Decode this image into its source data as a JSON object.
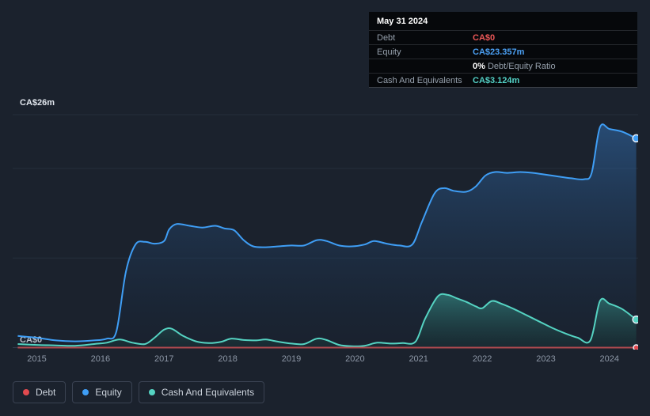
{
  "tooltip": {
    "date": "May 31 2024",
    "debt_label": "Debt",
    "debt_value": "CA$0",
    "equity_label": "Equity",
    "equity_value": "CA$23.357m",
    "ratio_value": "0%",
    "ratio_label": "Debt/Equity Ratio",
    "cash_label": "Cash And Equivalents",
    "cash_value": "CA$3.124m"
  },
  "axis": {
    "y_top_label": "CA$26m",
    "y_bottom_label": "CA$0"
  },
  "legend": [
    {
      "label": "Debt",
      "color": "#e14a4f"
    },
    {
      "label": "Equity",
      "color": "#3f9ef5"
    },
    {
      "label": "Cash And Equivalents",
      "color": "#55d3c2"
    }
  ],
  "chart_data": {
    "type": "area",
    "x_ticks": [
      2015,
      2016,
      2017,
      2018,
      2019,
      2020,
      2021,
      2022,
      2023,
      2024
    ],
    "xlim": [
      2014.62,
      2024.45
    ],
    "ylim": [
      0,
      26
    ],
    "y_gridlines": [
      26,
      20,
      10,
      0
    ],
    "y_tick_labels": {
      "top": "CA$26m",
      "bottom": "CA$0"
    },
    "legend_position": "bottom-left",
    "series": [
      {
        "name": "Equity",
        "color": "#3f9ef5",
        "line_width": 2,
        "fill_top": "rgba(52,116,186,0.50)",
        "fill_bottom": "rgba(18,32,52,0.18)",
        "marker_r": 4.5,
        "points": [
          [
            2014.7,
            1.3
          ],
          [
            2015.0,
            1.1
          ],
          [
            2015.3,
            0.8
          ],
          [
            2015.6,
            0.7
          ],
          [
            2015.9,
            0.8
          ],
          [
            2016.1,
            1.0
          ],
          [
            2016.25,
            1.8
          ],
          [
            2016.4,
            8.5
          ],
          [
            2016.55,
            11.5
          ],
          [
            2016.7,
            11.8
          ],
          [
            2016.85,
            11.6
          ],
          [
            2017.0,
            11.9
          ],
          [
            2017.08,
            13.2
          ],
          [
            2017.2,
            13.8
          ],
          [
            2017.4,
            13.6
          ],
          [
            2017.6,
            13.4
          ],
          [
            2017.8,
            13.6
          ],
          [
            2017.95,
            13.3
          ],
          [
            2018.1,
            13.1
          ],
          [
            2018.25,
            12.0
          ],
          [
            2018.4,
            11.3
          ],
          [
            2018.6,
            11.2
          ],
          [
            2018.8,
            11.3
          ],
          [
            2019.0,
            11.4
          ],
          [
            2019.2,
            11.4
          ],
          [
            2019.4,
            12.0
          ],
          [
            2019.55,
            11.9
          ],
          [
            2019.75,
            11.4
          ],
          [
            2019.95,
            11.3
          ],
          [
            2020.15,
            11.5
          ],
          [
            2020.3,
            11.9
          ],
          [
            2020.5,
            11.6
          ],
          [
            2020.7,
            11.4
          ],
          [
            2020.9,
            11.5
          ],
          [
            2021.05,
            14.0
          ],
          [
            2021.25,
            17.2
          ],
          [
            2021.4,
            17.8
          ],
          [
            2021.55,
            17.5
          ],
          [
            2021.75,
            17.4
          ],
          [
            2021.9,
            18.0
          ],
          [
            2022.05,
            19.2
          ],
          [
            2022.2,
            19.6
          ],
          [
            2022.4,
            19.5
          ],
          [
            2022.6,
            19.6
          ],
          [
            2022.8,
            19.5
          ],
          [
            2023.0,
            19.3
          ],
          [
            2023.2,
            19.1
          ],
          [
            2023.4,
            18.9
          ],
          [
            2023.6,
            18.8
          ],
          [
            2023.72,
            19.5
          ],
          [
            2023.85,
            24.6
          ],
          [
            2024.0,
            24.4
          ],
          [
            2024.2,
            24.1
          ],
          [
            2024.42,
            23.357
          ]
        ]
      },
      {
        "name": "Cash And Equivalents",
        "color": "#55d3c2",
        "line_width": 2,
        "fill_top": "rgba(66,186,168,0.45)",
        "fill_bottom": "rgba(22,64,58,0.25)",
        "marker_r": 4.5,
        "points": [
          [
            2014.7,
            0.4
          ],
          [
            2015.0,
            0.3
          ],
          [
            2015.3,
            0.25
          ],
          [
            2015.6,
            0.2
          ],
          [
            2015.9,
            0.4
          ],
          [
            2016.1,
            0.55
          ],
          [
            2016.3,
            0.9
          ],
          [
            2016.5,
            0.55
          ],
          [
            2016.7,
            0.4
          ],
          [
            2016.85,
            1.1
          ],
          [
            2017.0,
            2.0
          ],
          [
            2017.12,
            2.1
          ],
          [
            2017.3,
            1.3
          ],
          [
            2017.5,
            0.7
          ],
          [
            2017.7,
            0.5
          ],
          [
            2017.9,
            0.65
          ],
          [
            2018.05,
            1.0
          ],
          [
            2018.25,
            0.85
          ],
          [
            2018.45,
            0.8
          ],
          [
            2018.6,
            0.9
          ],
          [
            2018.8,
            0.65
          ],
          [
            2019.0,
            0.45
          ],
          [
            2019.2,
            0.4
          ],
          [
            2019.4,
            1.0
          ],
          [
            2019.55,
            0.85
          ],
          [
            2019.75,
            0.3
          ],
          [
            2019.95,
            0.15
          ],
          [
            2020.15,
            0.2
          ],
          [
            2020.35,
            0.55
          ],
          [
            2020.55,
            0.45
          ],
          [
            2020.75,
            0.5
          ],
          [
            2020.95,
            0.65
          ],
          [
            2021.1,
            3.2
          ],
          [
            2021.3,
            5.7
          ],
          [
            2021.45,
            5.9
          ],
          [
            2021.6,
            5.5
          ],
          [
            2021.75,
            5.1
          ],
          [
            2021.9,
            4.6
          ],
          [
            2022.0,
            4.4
          ],
          [
            2022.15,
            5.2
          ],
          [
            2022.3,
            4.9
          ],
          [
            2022.5,
            4.3
          ],
          [
            2022.7,
            3.6
          ],
          [
            2022.9,
            2.9
          ],
          [
            2023.1,
            2.2
          ],
          [
            2023.3,
            1.6
          ],
          [
            2023.5,
            1.1
          ],
          [
            2023.7,
            0.8
          ],
          [
            2023.85,
            5.2
          ],
          [
            2024.0,
            4.9
          ],
          [
            2024.2,
            4.3
          ],
          [
            2024.42,
            3.124
          ]
        ]
      },
      {
        "name": "Debt",
        "color": "#b04a50",
        "line_width": 2,
        "marker_color": "#e14a4f",
        "marker_r": 3.5,
        "points": [
          [
            2014.7,
            0
          ],
          [
            2016.0,
            0
          ],
          [
            2018.0,
            0
          ],
          [
            2020.0,
            0
          ],
          [
            2022.0,
            0
          ],
          [
            2024.42,
            0
          ]
        ]
      }
    ]
  }
}
